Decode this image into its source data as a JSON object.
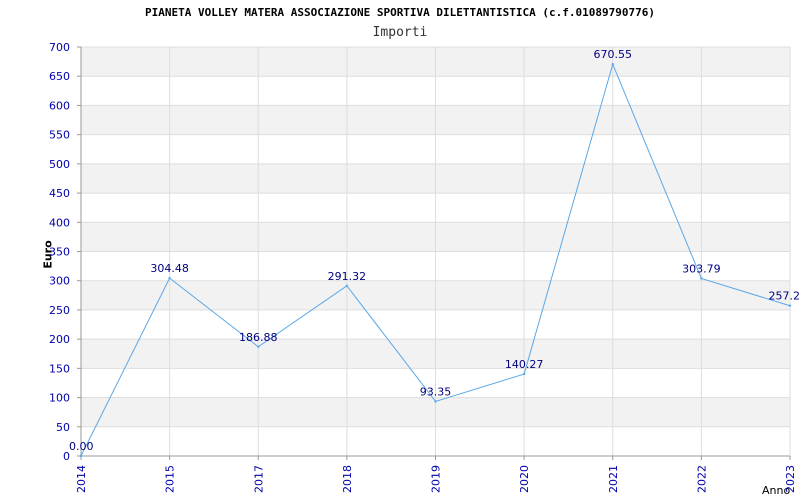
{
  "chart_data": {
    "type": "line",
    "title": "PIANETA VOLLEY MATERA ASSOCIAZIONE SPORTIVA DILETTANTISTICA (c.f.01089790776)",
    "subtitle": "Importi",
    "xlabel": "Anno",
    "ylabel": "Euro",
    "categories": [
      "2014",
      "2015",
      "2017",
      "2018",
      "2019",
      "2020",
      "2021",
      "2022",
      "2023"
    ],
    "series": [
      {
        "values": [
          0.0,
          304.48,
          186.88,
          291.32,
          93.35,
          140.27,
          670.55,
          303.79,
          257.2
        ],
        "labels": [
          "0.00",
          "304.48",
          "186.88",
          "291.32",
          "93.35",
          "140.27",
          "670.55",
          "303.79",
          "257.2"
        ]
      }
    ],
    "ylim": [
      0,
      700
    ],
    "yticks": [
      "0",
      "50",
      "100",
      "150",
      "200",
      "250",
      "300",
      "350",
      "400",
      "450",
      "500",
      "550",
      "600",
      "650",
      "700"
    ],
    "grid": true,
    "colors": {
      "line": "#5ba8e8",
      "tick_text": "#0000aa",
      "label_text": "#000080",
      "band": "#f2f2f2",
      "gridline": "#dddddd"
    }
  }
}
